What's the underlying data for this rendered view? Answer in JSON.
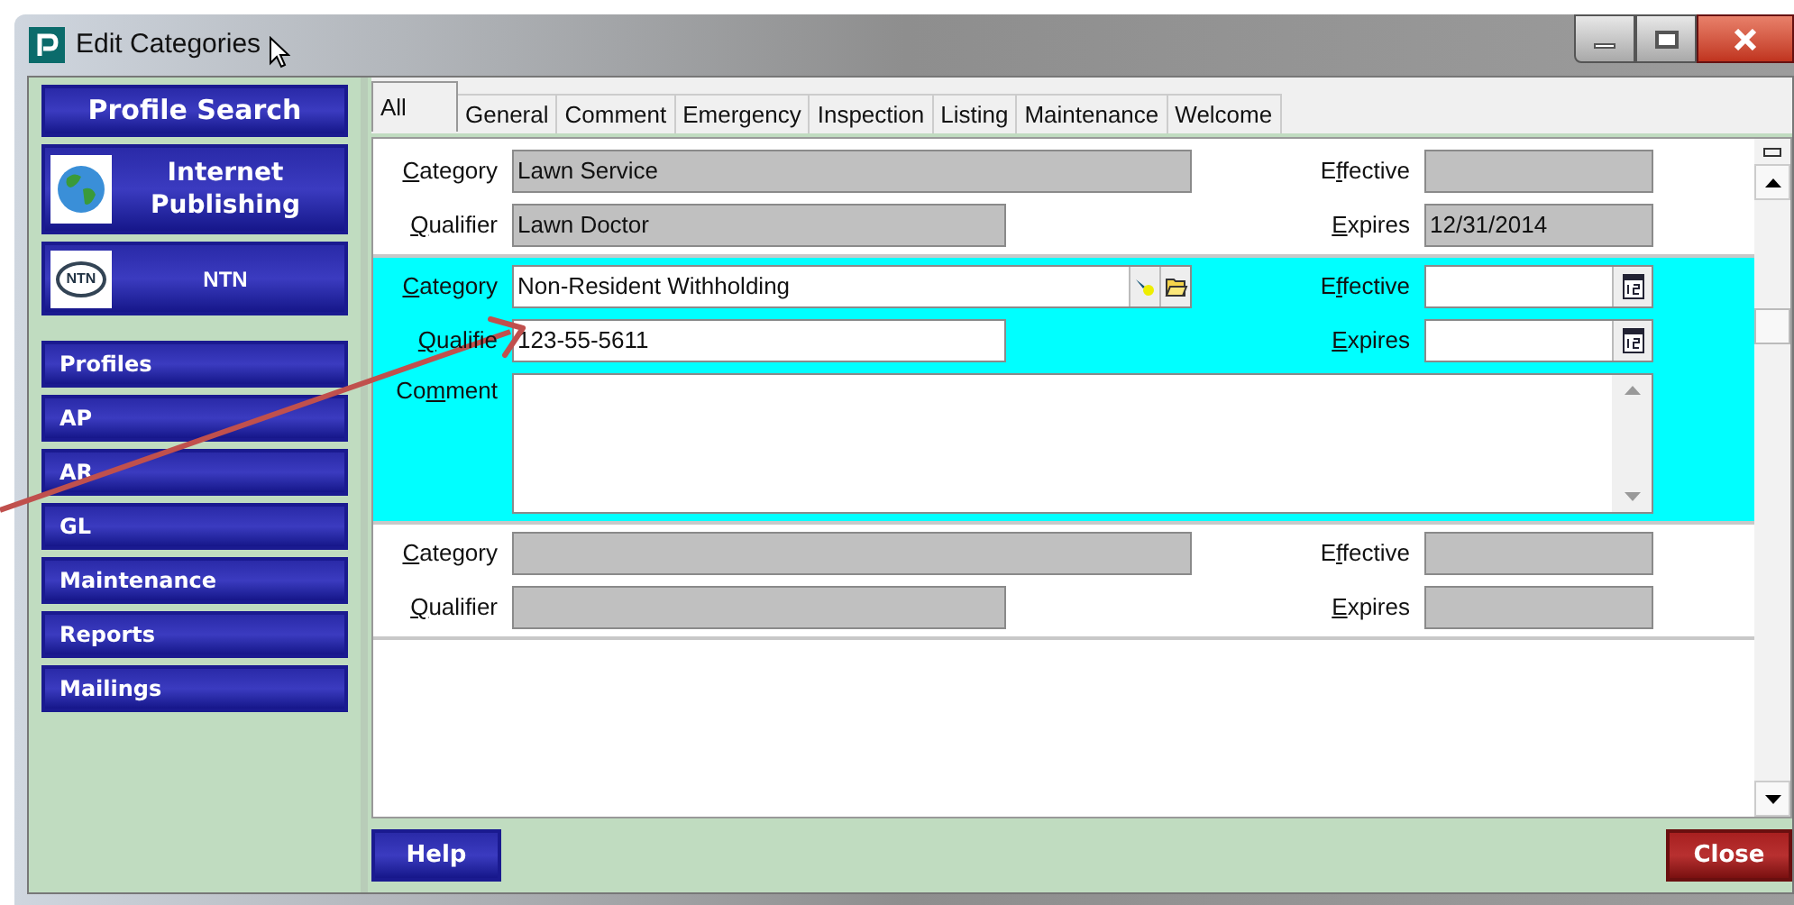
{
  "window": {
    "title": "Edit Categories"
  },
  "sidebar": {
    "items": [
      {
        "kind": "title",
        "label": "Profile Search"
      },
      {
        "kind": "globe",
        "label": "Internet Publishing"
      },
      {
        "kind": "emblem",
        "label": "NTN",
        "logo_text": "NTN"
      },
      {
        "kind": "nav",
        "label": "Profiles"
      },
      {
        "kind": "nav",
        "label": "AP"
      },
      {
        "kind": "nav",
        "label": "AR"
      },
      {
        "kind": "nav",
        "label": "GL"
      },
      {
        "kind": "nav",
        "label": "Maintenance"
      },
      {
        "kind": "nav",
        "label": "Reports"
      },
      {
        "kind": "nav",
        "label": "Mailings"
      }
    ]
  },
  "tabs": [
    {
      "label": "All",
      "selected": true
    },
    {
      "label": "General",
      "selected": false
    },
    {
      "label": "Comment",
      "selected": false
    },
    {
      "label": "Emergency",
      "selected": false
    },
    {
      "label": "Inspection",
      "selected": false
    },
    {
      "label": "Listing",
      "selected": false
    },
    {
      "label": "Maintenance",
      "selected": false
    },
    {
      "label": "Welcome",
      "selected": false
    }
  ],
  "records": [
    {
      "selected": false,
      "labels": {
        "category": {
          "key": "C",
          "post": "ategory"
        },
        "qualifier": {
          "key": "Q",
          "post": "ualifier"
        },
        "effective": {
          "pre": "E",
          "key": "f",
          "post": "fective"
        },
        "expires": {
          "key": "E",
          "post": "xpires"
        }
      },
      "category": "Lawn Service",
      "qualifier": "Lawn Doctor",
      "expires": "12/31/2014"
    },
    {
      "selected": true,
      "labels": {
        "category": {
          "key": "C",
          "post": "ategory"
        },
        "qualifier": {
          "key": "Q",
          "post": "ualifie"
        },
        "effective": {
          "pre": "E",
          "key": "f",
          "post": "fective"
        },
        "expires": {
          "key": "E",
          "post": "xpires"
        },
        "comment": {
          "pre": "Co",
          "key": "m",
          "post": "ment"
        }
      },
      "category": "Non-Resident Withholding",
      "qualifier": "123-55-5611"
    },
    {
      "selected": false,
      "labels": {
        "category": {
          "key": "C",
          "post": "ategory"
        },
        "qualifier": {
          "key": "Q",
          "post": "ualifier"
        },
        "effective": {
          "pre": "E",
          "key": "f",
          "post": "fective"
        },
        "expires": {
          "key": "E",
          "post": "xpires"
        }
      }
    }
  ],
  "buttons": {
    "help": "Help",
    "close": "Close"
  }
}
